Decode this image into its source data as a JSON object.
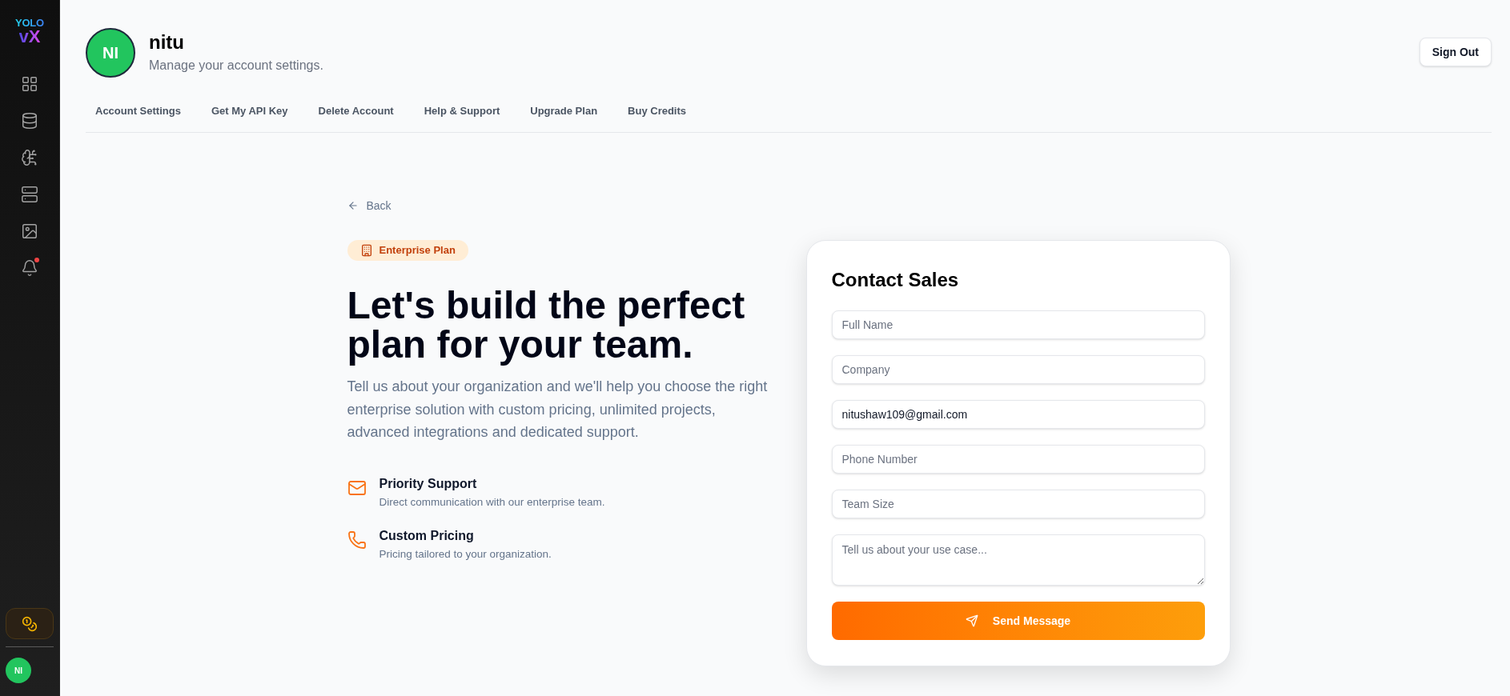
{
  "sidebar": {
    "logo": {
      "top": "YOLO",
      "bottom": "vX"
    },
    "notifications": {
      "unread": true
    },
    "avatar": {
      "initials": "NI"
    }
  },
  "header": {
    "avatar": {
      "initials": "NI"
    },
    "name": "nitu",
    "subtitle": "Manage your account settings.",
    "sign_out": "Sign Out"
  },
  "tabs": [
    {
      "label": "Account Settings"
    },
    {
      "label": "Get My API Key"
    },
    {
      "label": "Delete Account"
    },
    {
      "label": "Help & Support"
    },
    {
      "label": "Upgrade Plan"
    },
    {
      "label": "Buy Credits"
    }
  ],
  "back": "Back",
  "hero": {
    "badge": "Enterprise Plan",
    "title": "Let's build the perfect plan for your team.",
    "description": "Tell us about your organization and we'll help you choose the right enterprise solution with custom pricing, unlimited projects, advanced integrations and dedicated support.",
    "features": [
      {
        "title": "Priority Support",
        "description": "Direct communication with our enterprise team."
      },
      {
        "title": "Custom Pricing",
        "description": "Pricing tailored to your organization."
      }
    ]
  },
  "contact_form": {
    "title": "Contact Sales",
    "fields": [
      {
        "kind": "input",
        "placeholder": "Full Name"
      },
      {
        "kind": "input",
        "placeholder": "Company"
      },
      {
        "kind": "input",
        "value": "nitushaw109@gmail.com"
      },
      {
        "kind": "input",
        "placeholder": "Phone Number"
      },
      {
        "kind": "input",
        "placeholder": "Team Size"
      },
      {
        "kind": "textarea",
        "placeholder": "Tell us about your use case..."
      }
    ],
    "submit": "Send Message"
  }
}
